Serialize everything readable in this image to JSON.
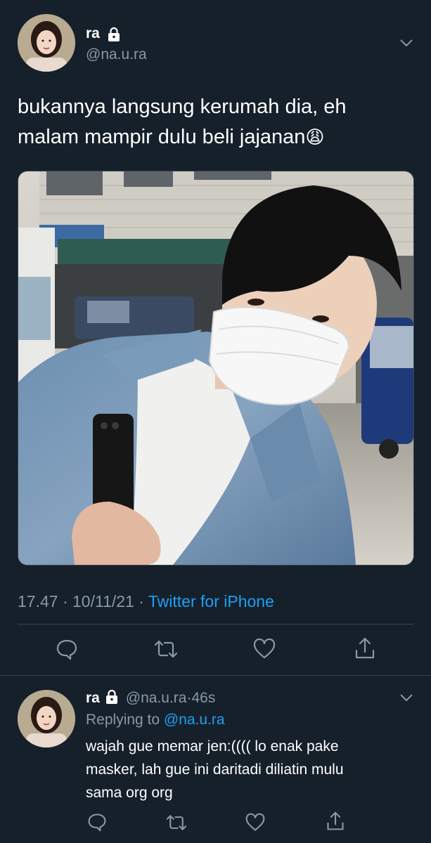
{
  "tweet": {
    "author_name": "ra",
    "author_handle": "@na.u.ra",
    "text_line1": "bukannya langsung kerumah dia, eh",
    "text_line2": "malam mampir dulu beli jajanan",
    "emoji": "😩",
    "time": "17.47",
    "date": "10/11/21",
    "separator": "·",
    "source": "Twitter for iPhone"
  },
  "reply": {
    "author_name": "ra",
    "author_handle": "@na.u.ra",
    "age": "46s",
    "replying_label": "Replying to",
    "replying_to": "@na.u.ra",
    "text_line1": "wajah gue memar jen:(((( lo enak pake",
    "text_line2": "masker, lah gue ini daritadi diliatin mulu",
    "text_line3": "sama org org"
  },
  "colors": {
    "background": "#15202b",
    "secondary_text": "#8899a6",
    "link": "#1da1f2",
    "divider": "#38444d"
  },
  "icons": [
    "lock-icon",
    "chevron-down-icon",
    "reply-icon",
    "retweet-icon",
    "like-icon",
    "share-icon"
  ]
}
